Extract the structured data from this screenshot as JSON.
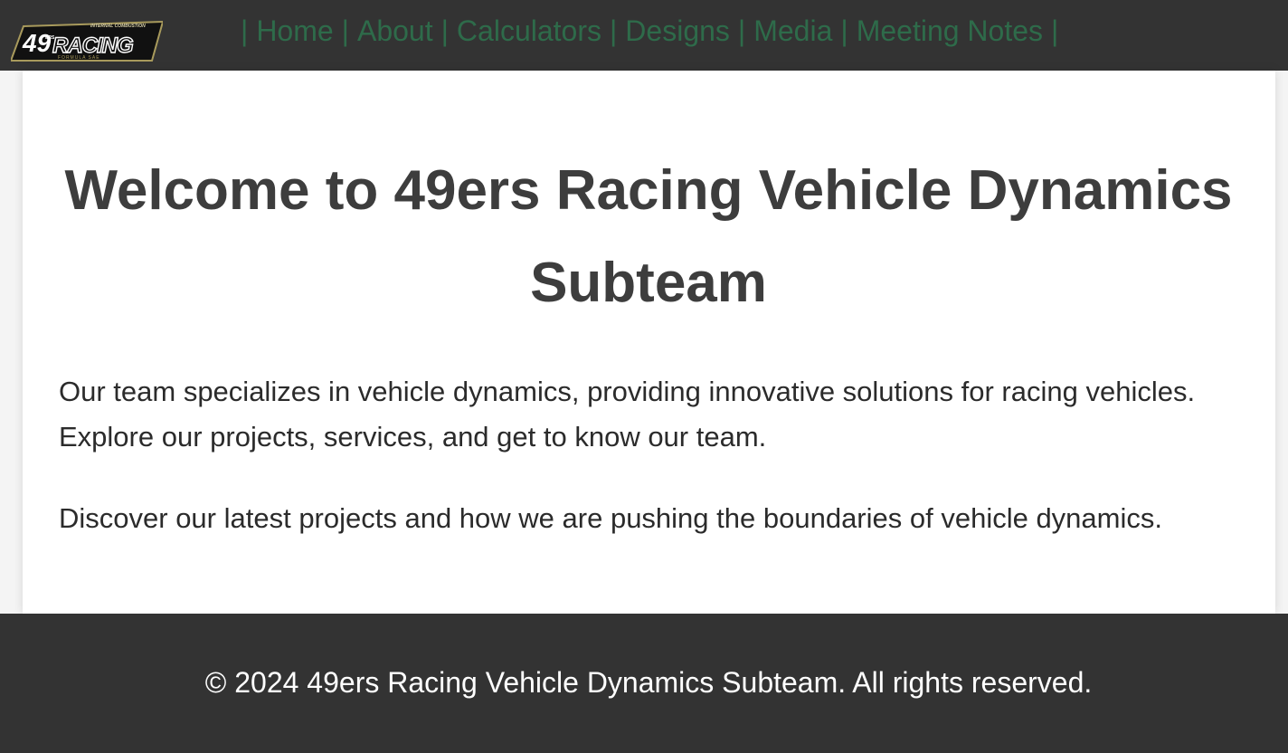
{
  "logo": {
    "number": "49",
    "small": "ERS",
    "word": "RACING",
    "tagline_top": "INTERNAL COMBUSTION",
    "tagline_bottom": "FORMULA SAE"
  },
  "nav": {
    "separator": "|",
    "items": [
      "Home",
      "About",
      "Calculators",
      "Designs",
      "Media",
      "Meeting Notes"
    ]
  },
  "main": {
    "title": "Welcome to 49ers Racing Vehicle Dynamics Subteam",
    "paragraph1": "Our team specializes in vehicle dynamics, providing innovative solutions for racing vehicles. Explore our projects, services, and get to know our team.",
    "paragraph2": "Discover our latest projects and how we are pushing the boundaries of vehicle dynamics."
  },
  "footer": {
    "text": "© 2024 49ers Racing Vehicle Dynamics Subteam. All rights reserved."
  },
  "colors": {
    "header_bg": "#333333",
    "nav_link": "#2e6b4a",
    "logo_gold": "#a89a5c",
    "title": "#3d3d3d"
  }
}
